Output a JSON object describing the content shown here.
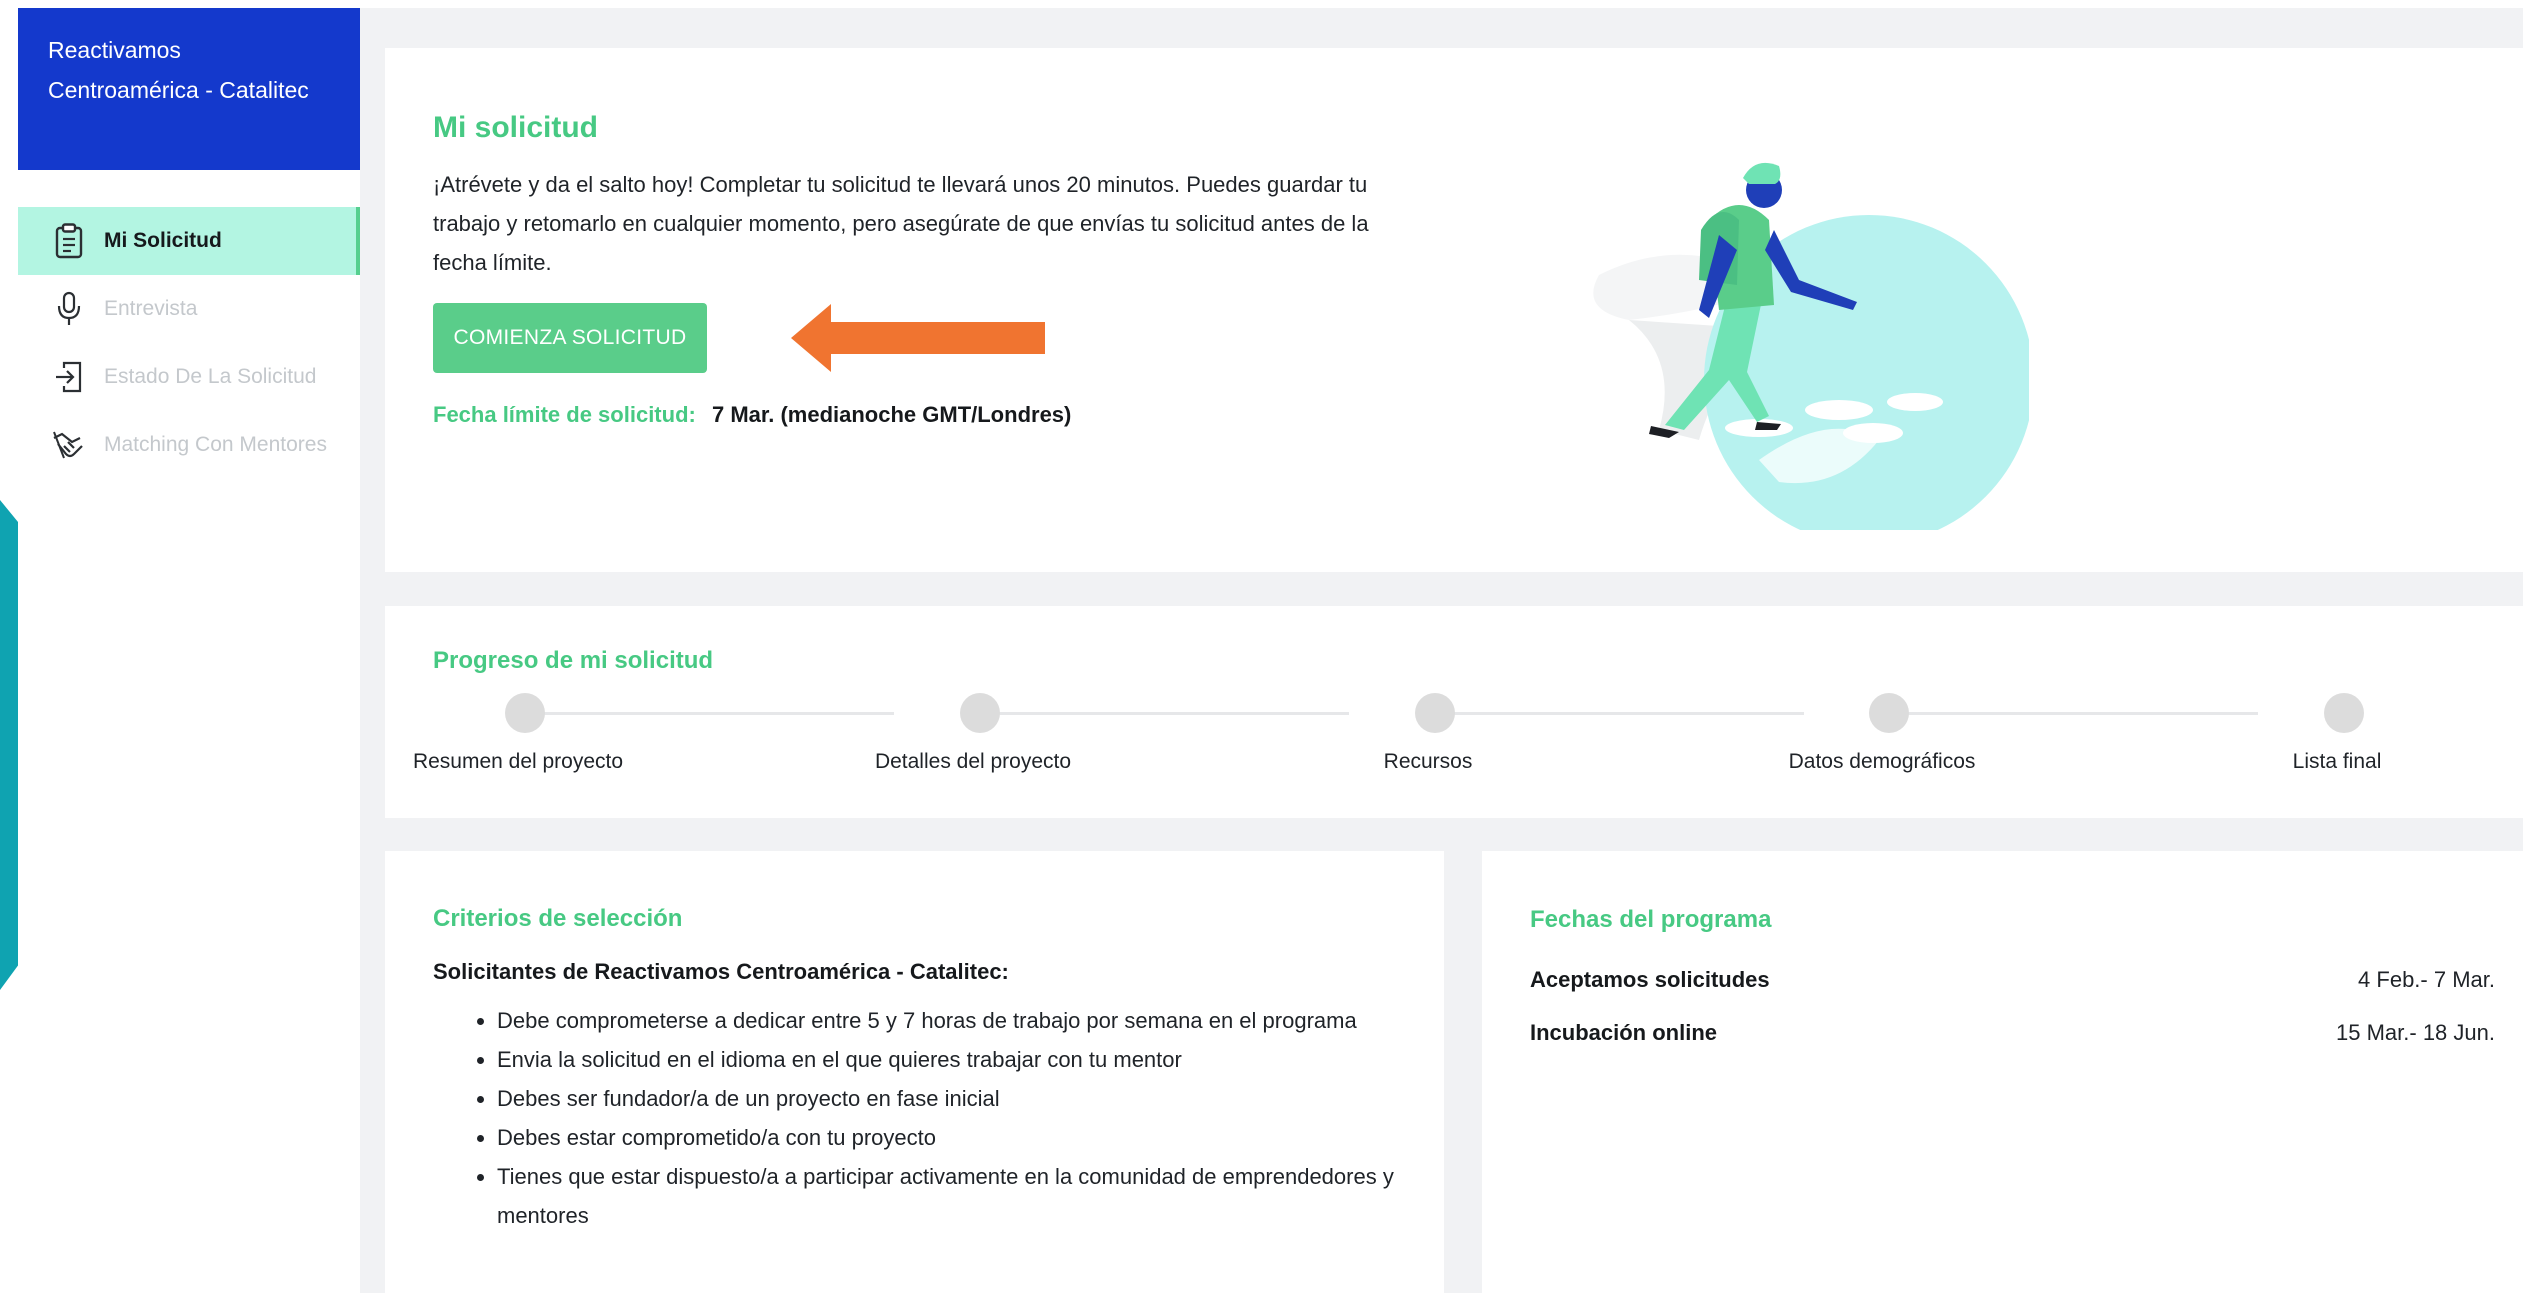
{
  "sidebar": {
    "brand_line1": "Reactivamos",
    "brand_line2": "Centroamérica - Catalitec",
    "items": [
      {
        "label": "Mi Solicitud",
        "icon": "clipboard-icon",
        "active": true
      },
      {
        "label": "Entrevista",
        "icon": "microphone-icon",
        "active": false
      },
      {
        "label": "Estado De La Solicitud",
        "icon": "sign-in-icon",
        "active": false
      },
      {
        "label": "Matching Con Mentores",
        "icon": "handshake-icon",
        "active": false
      }
    ]
  },
  "intro": {
    "title": "Mi solicitud",
    "text": "¡Atrévete y da el salto hoy! Completar tu solicitud te llevará unos 20 minutos. Puedes guardar tu trabajo y retomarlo en cualquier momento, pero asegúrate de que envías tu solicitud antes de la fecha límite.",
    "button": "COMIENZA SOLICITUD",
    "deadline_label": "Fecha límite de solicitud:",
    "deadline_value": "7 Mar. (medianoche GMT/Londres)"
  },
  "progress": {
    "title": "Progreso de mi solicitud",
    "steps": [
      "Resumen del proyecto",
      "Detalles del proyecto",
      "Recursos",
      "Datos demográficos",
      "Lista final"
    ]
  },
  "criteria": {
    "title": "Criterios de selección",
    "subtitle": "Solicitantes de Reactivamos Centroamérica - Catalitec:",
    "items": [
      "Debe comprometerse a dedicar entre 5 y 7 horas de trabajo por semana en el programa",
      "Envia la solicitud en el idioma en el que quieres trabajar con tu mentor",
      "Debes ser fundador/a de un proyecto en fase inicial",
      "Debes estar comprometido/a con tu proyecto",
      "Tienes que estar dispuesto/a a participar activamente en la comunidad de emprendedores y mentores"
    ]
  },
  "dates": {
    "title": "Fechas del programa",
    "rows": [
      {
        "label": "Aceptamos solicitudes",
        "value": "4 Feb.- 7 Mar."
      },
      {
        "label": "Incubación online",
        "value": "15 Mar.- 18 Jun."
      }
    ]
  },
  "colors": {
    "brand": "#1439cc",
    "accent_green": "#47c983",
    "button_green": "#5acd8a",
    "active_nav": "#b3f5e2",
    "arrow_orange": "#f07430",
    "teal_accent": "#0fa3b1"
  }
}
